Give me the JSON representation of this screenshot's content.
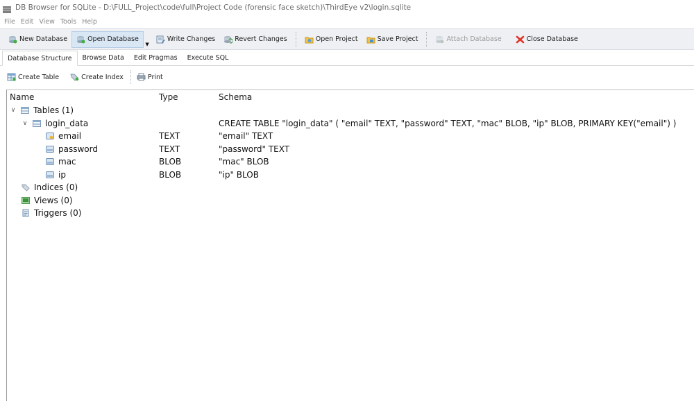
{
  "window": {
    "title": "DB Browser for SQLite - D:\\FULL_Project\\code\\full\\Project Code (forensic face sketch)\\ThirdEye v2\\login.sqlite"
  },
  "menu": [
    "File",
    "Edit",
    "View",
    "Tools",
    "Help"
  ],
  "toolbar": {
    "new_database": "New Database",
    "open_database": "Open Database",
    "write_changes": "Write Changes",
    "revert_changes": "Revert Changes",
    "open_project": "Open Project",
    "save_project": "Save Project",
    "attach_database": "Attach Database",
    "close_database": "Close Database"
  },
  "tabs": [
    "Database Structure",
    "Browse Data",
    "Edit Pragmas",
    "Execute SQL"
  ],
  "subtoolbar": {
    "create_table": "Create Table",
    "create_index": "Create Index",
    "print": "Print"
  },
  "tree": {
    "headers": {
      "name": "Name",
      "type": "Type",
      "schema": "Schema"
    },
    "tables_label": "Tables (1)",
    "table": {
      "name": "login_data",
      "schema": "CREATE TABLE \"login_data\" ( \"email\" TEXT, \"password\" TEXT, \"mac\" BLOB, \"ip\" BLOB, PRIMARY KEY(\"email\") )"
    },
    "fields": [
      {
        "name": "email",
        "type": "TEXT",
        "schema": "\"email\" TEXT"
      },
      {
        "name": "password",
        "type": "TEXT",
        "schema": "\"password\" TEXT"
      },
      {
        "name": "mac",
        "type": "BLOB",
        "schema": "\"mac\" BLOB"
      },
      {
        "name": "ip",
        "type": "BLOB",
        "schema": "\"ip\" BLOB"
      }
    ],
    "indices_label": "Indices (0)",
    "views_label": "Views (0)",
    "triggers_label": "Triggers (0)"
  }
}
